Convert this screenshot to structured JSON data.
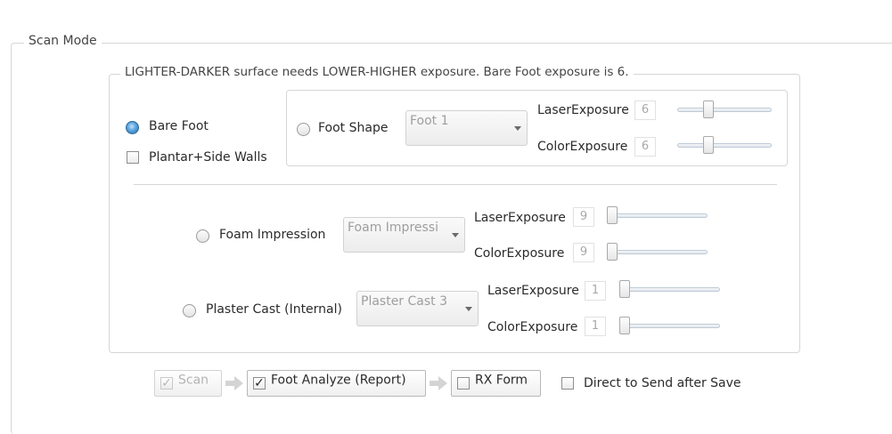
{
  "scan_mode": {
    "legend": "Scan Mode",
    "hint": "LIGHTER-DARKER surface needs LOWER-HIGHER exposure. Bare Foot exposure is 6.",
    "bare_foot": {
      "label": "Bare Foot",
      "selected": true
    },
    "plantar_side_walls": {
      "label": "Plantar+Side Walls",
      "checked": false
    },
    "foot_shape": {
      "label": "Foot Shape",
      "selected": false,
      "combo_value": "Foot 1",
      "laser_label": "LaserExposure",
      "laser_value": "6",
      "laser_level": 6,
      "color_label": "ColorExposure",
      "color_value": "6",
      "color_level": 6
    },
    "foam_impression": {
      "label": "Foam Impression",
      "selected": false,
      "combo_value": "Foam Impressi",
      "laser_label": "LaserExposure",
      "laser_value": "9",
      "laser_level": 0,
      "color_label": "ColorExposure",
      "color_value": "9",
      "color_level": 0
    },
    "plaster_cast": {
      "label": "Plaster Cast (Internal)",
      "selected": false,
      "combo_value": "Plaster Cast 3",
      "laser_label": "LaserExposure",
      "laser_value": "1",
      "laser_level": 0,
      "color_label": "ColorExposure",
      "color_value": "1",
      "color_level": 0
    }
  },
  "workflow": {
    "scan": {
      "label": "Scan",
      "checked": true,
      "enabled": false
    },
    "foot_analyze": {
      "label": "Foot Analyze (Report)",
      "checked": true,
      "enabled": true
    },
    "rx_form": {
      "label": "RX Form",
      "checked": false,
      "enabled": true
    },
    "direct_send": {
      "label": "Direct to Send after Save",
      "checked": false,
      "enabled": true
    }
  },
  "icons": {
    "check_mark": "✓",
    "flow_arrow": "flow-arrow-icon"
  }
}
